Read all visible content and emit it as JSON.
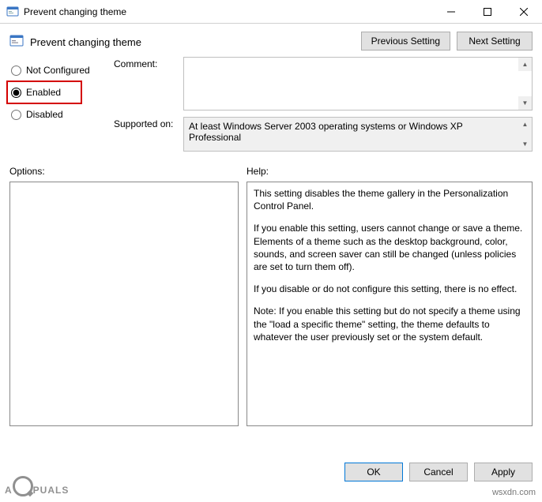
{
  "window": {
    "title": "Prevent changing theme"
  },
  "header": {
    "title": "Prevent changing theme",
    "prev_btn": "Previous Setting",
    "next_btn": "Next Setting"
  },
  "radios": {
    "not_configured": "Not Configured",
    "enabled": "Enabled",
    "disabled": "Disabled"
  },
  "labels": {
    "comment": "Comment:",
    "supported": "Supported on:",
    "options": "Options:",
    "help": "Help:"
  },
  "supported_text": "At least Windows Server 2003 operating systems or Windows XP Professional",
  "help": {
    "p1": "This setting disables the theme gallery in the Personalization Control Panel.",
    "p2": "If you enable this setting, users cannot change or save a theme. Elements of a theme such as the desktop background, color, sounds, and screen saver can still be changed (unless policies are set to turn them off).",
    "p3": "If you disable or do not configure this setting, there is no effect.",
    "p4": "Note: If you enable this setting but do not specify a theme using the \"load a specific theme\" setting, the theme defaults to whatever the user previously set or the system default."
  },
  "buttons": {
    "ok": "OK",
    "cancel": "Cancel",
    "apply": "Apply"
  },
  "watermark": {
    "brand_left": "A",
    "brand_right": "PUALS",
    "site": "wsxdn.com"
  }
}
